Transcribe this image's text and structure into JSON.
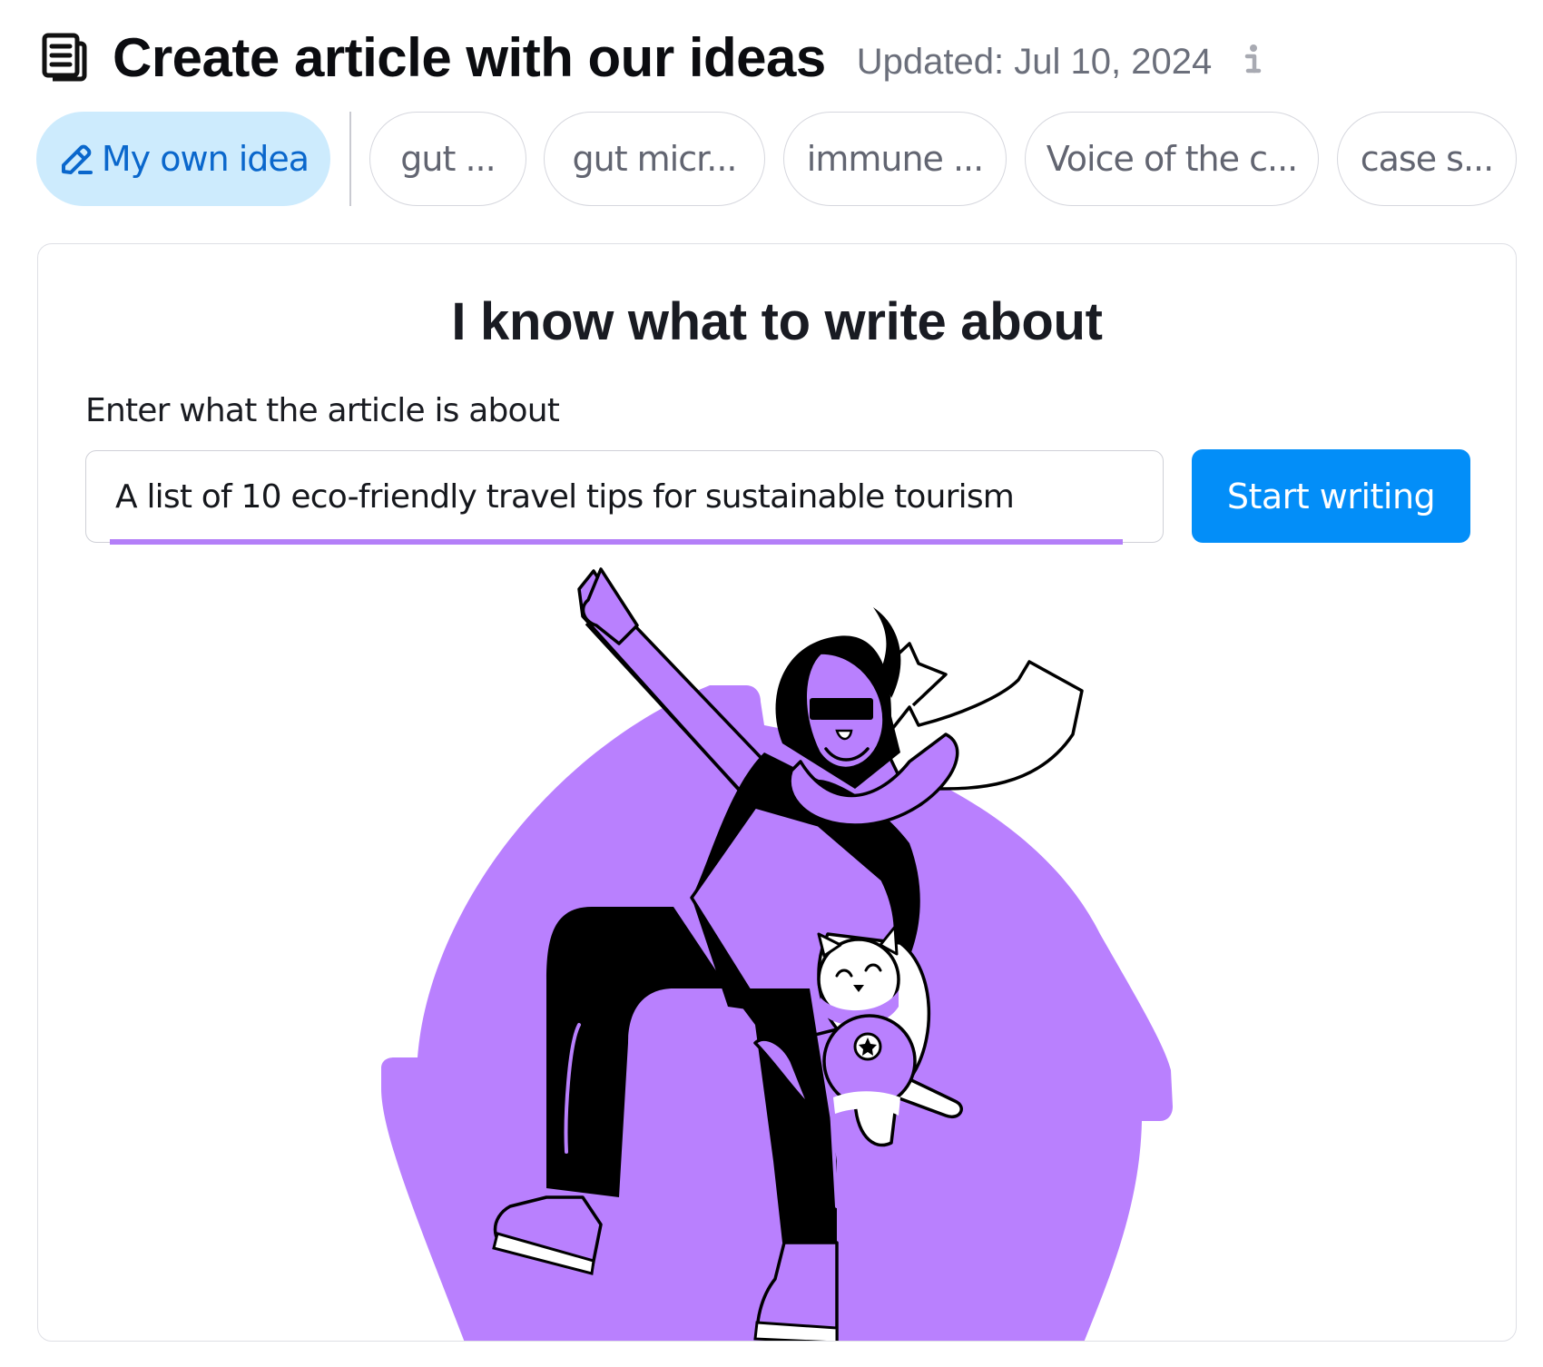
{
  "header": {
    "icon": "document-icon",
    "title": "Create article with our ideas",
    "updated": "Updated: Jul 10, 2024",
    "info_icon": "info-icon"
  },
  "chips": {
    "active": {
      "label": "My own idea",
      "icon": "pencil-icon"
    },
    "ideas": [
      {
        "label": "gut ..."
      },
      {
        "label": "gut micr..."
      },
      {
        "label": "immune ..."
      },
      {
        "label": "Voice of the c..."
      },
      {
        "label": "case s..."
      }
    ]
  },
  "card": {
    "heading": "I know what to write about",
    "field_label": "Enter what the article is about",
    "input_value": "A list of 10 eco-friendly travel tips for sustainable tourism",
    "start_button": "Start writing",
    "illustration": "person-with-cat-illustration"
  },
  "colors": {
    "accent_blue": "#038ef8",
    "active_chip_bg": "#cdebfd",
    "active_chip_text": "#0a67cc",
    "illustration_purple": "#b980fe",
    "input_underline": "#b47ff8"
  }
}
